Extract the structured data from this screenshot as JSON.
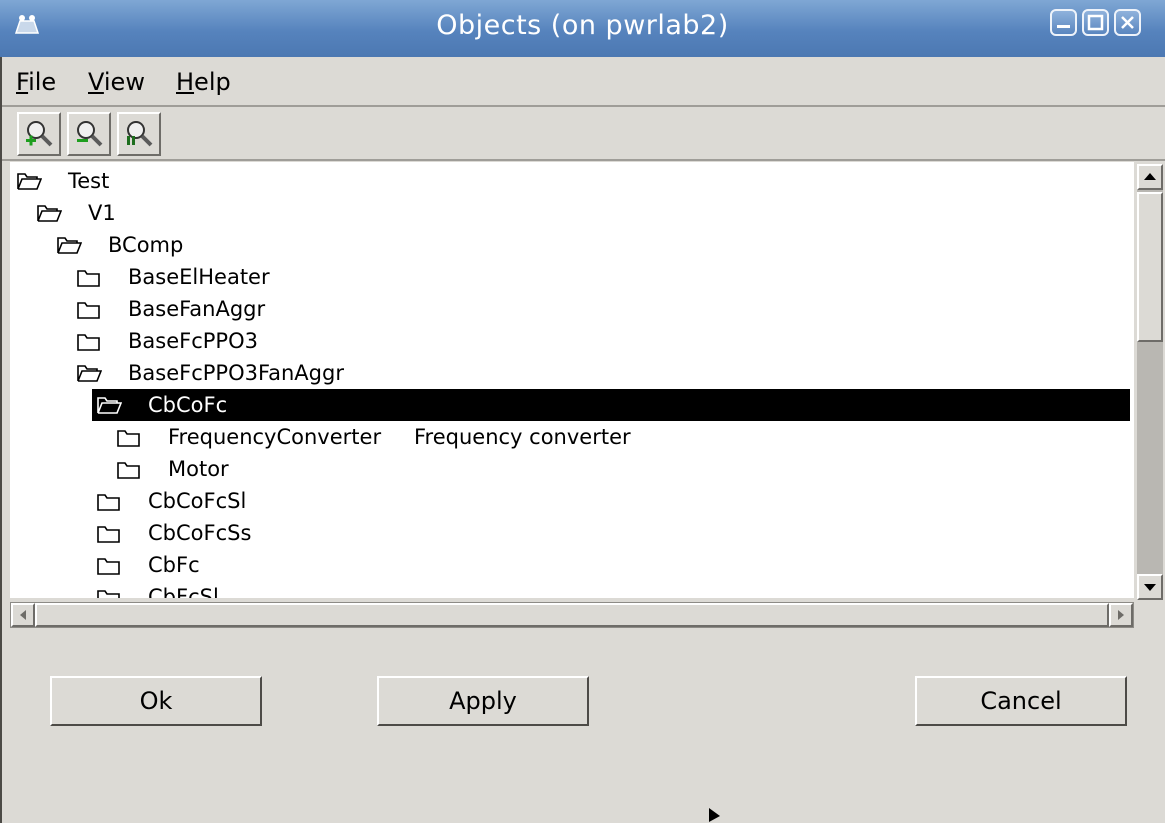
{
  "window": {
    "title": "Objects (on pwrlab2)",
    "controls": [
      "minimize-icon",
      "maximize-icon",
      "close-icon"
    ],
    "title_bar_color": "#5683bd"
  },
  "menu": {
    "items": [
      {
        "mnemonic": "F",
        "rest": "ile"
      },
      {
        "mnemonic": "V",
        "rest": "iew"
      },
      {
        "mnemonic": "H",
        "rest": "elp"
      }
    ]
  },
  "toolbar": {
    "buttons": [
      "zoom-in-icon",
      "zoom-out-icon",
      "zoom-reset-icon"
    ]
  },
  "tree": {
    "rows": [
      {
        "label": "Test",
        "desc": "",
        "expanded": true,
        "selected": false
      },
      {
        "label": "V1",
        "desc": "",
        "expanded": true,
        "selected": false
      },
      {
        "label": "BComp",
        "desc": "",
        "expanded": true,
        "selected": false
      },
      {
        "label": "BaseElHeater",
        "desc": "",
        "expanded": false,
        "selected": false
      },
      {
        "label": "BaseFanAggr",
        "desc": "",
        "expanded": false,
        "selected": false
      },
      {
        "label": "BaseFcPPO3",
        "desc": "",
        "expanded": false,
        "selected": false
      },
      {
        "label": "BaseFcPPO3FanAggr",
        "desc": "",
        "expanded": true,
        "selected": false
      },
      {
        "label": "CbCoFc",
        "desc": "",
        "expanded": true,
        "selected": true
      },
      {
        "label": "FrequencyConverter",
        "desc": "Frequency converter",
        "expanded": false,
        "selected": false
      },
      {
        "label": "Motor",
        "desc": "",
        "expanded": false,
        "selected": false
      },
      {
        "label": "CbCoFcSl",
        "desc": "",
        "expanded": false,
        "selected": false
      },
      {
        "label": "CbCoFcSs",
        "desc": "",
        "expanded": false,
        "selected": false
      },
      {
        "label": "CbFc",
        "desc": "",
        "expanded": false,
        "selected": false
      },
      {
        "label": "CbFcSl",
        "desc": "",
        "expanded": false,
        "selected": false
      }
    ]
  },
  "buttons": {
    "ok": "Ok",
    "apply": "Apply",
    "cancel": "Cancel"
  }
}
